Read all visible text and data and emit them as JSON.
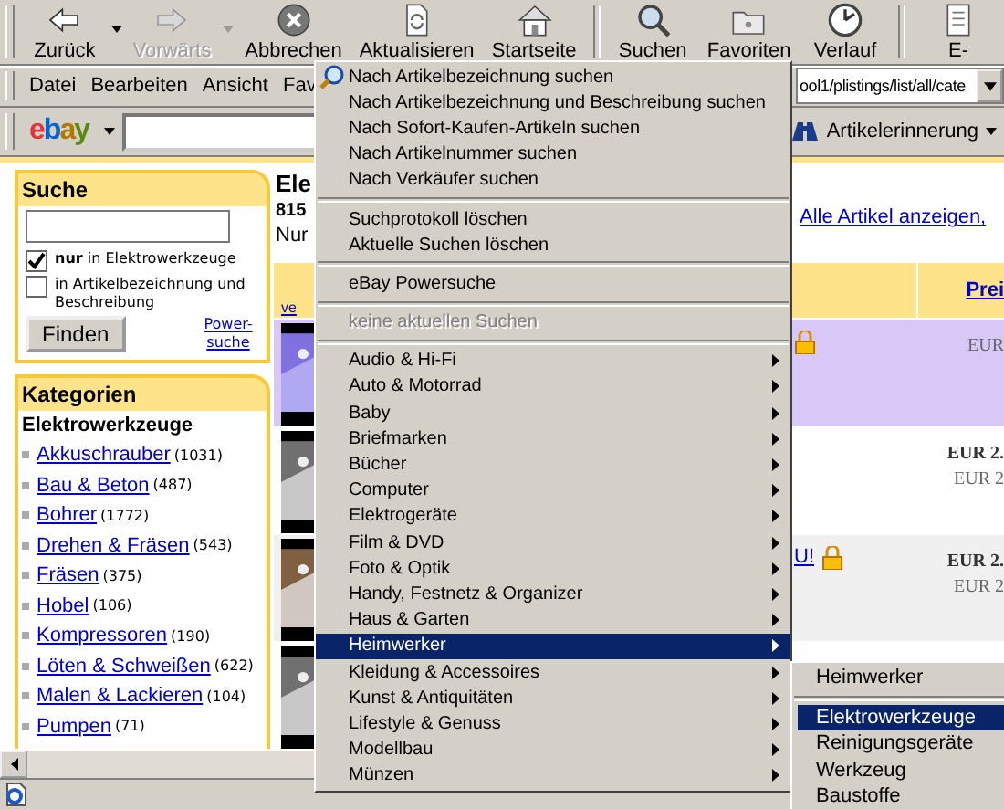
{
  "toolbar": {
    "buttons": [
      {
        "label": "Zurück",
        "disabled": false,
        "dropdown": true
      },
      {
        "label": "Vorwärts",
        "disabled": true,
        "dropdown": true
      },
      {
        "label": "Abbrechen",
        "disabled": false,
        "dropdown": false
      },
      {
        "label": "Aktualisieren",
        "disabled": false,
        "dropdown": false
      },
      {
        "label": "Startseite",
        "disabled": false,
        "dropdown": false
      },
      {
        "label": "Suchen",
        "disabled": false,
        "dropdown": false
      },
      {
        "label": "Favoriten",
        "disabled": false,
        "dropdown": false
      },
      {
        "label": "Verlauf",
        "disabled": false,
        "dropdown": false
      },
      {
        "label": "E-",
        "disabled": false,
        "dropdown": false
      }
    ]
  },
  "menu_bar": {
    "items": [
      "Datei",
      "Bearbeiten",
      "Ansicht",
      "Fav"
    ]
  },
  "address": {
    "value": "ool1/plistings/list/all/cate"
  },
  "ebay_toolbar": {
    "logo": "ebay",
    "button": "Artikelerinnerung"
  },
  "search_box": {
    "title": "Suche",
    "options": [
      {
        "label": "**nur** in Elektrowerkzeuge",
        "checked": true
      },
      {
        "label": "in Artikelbezeichnung und Beschreibung",
        "checked": false
      }
    ],
    "button": "Finden",
    "link": "Power-suche"
  },
  "categories": {
    "title": "Kategorien",
    "heading": "Elektrowerkzeuge",
    "items": [
      {
        "name": "Akkuschrauber",
        "count": "(1031)"
      },
      {
        "name": "Bau & Beton",
        "count": "(487)"
      },
      {
        "name": "Bohrer",
        "count": "(1772)"
      },
      {
        "name": "Drehen & Fräsen",
        "count": "(543)"
      },
      {
        "name": "Fräsen",
        "count": "(375)"
      },
      {
        "name": "Hobel",
        "count": "(106)"
      },
      {
        "name": "Kompressoren",
        "count": "(190)"
      },
      {
        "name": "Löten & Schweißen",
        "count": "(622)"
      },
      {
        "name": "Malen & Lackieren",
        "count": "(104)"
      },
      {
        "name": "Pumpen",
        "count": "(71)"
      }
    ]
  },
  "page": {
    "title": "Ele",
    "count": "815",
    "note": "Nur",
    "view_link": "ve",
    "all_link": "Alle Artikel anzeigen,",
    "price_header": "Prei",
    "rows": [
      {
        "kind": "featured",
        "lock": true,
        "price": "EUR"
      },
      {
        "kind": "plain",
        "lock": false,
        "price": "EUR 2.",
        "sub": "EUR 2"
      },
      {
        "kind": "shaded",
        "lock": true,
        "link": "U!",
        "price": "EUR 2.",
        "sub": "EUR 2"
      },
      {
        "kind": "plain",
        "lock": false
      }
    ]
  },
  "menu": {
    "items": [
      {
        "kind": "item",
        "label": "Nach Artikelbezeichnung suchen",
        "icon": true
      },
      {
        "kind": "item",
        "label": "Nach Artikelbezeichnung und Beschreibung suchen"
      },
      {
        "kind": "item",
        "label": "Nach Sofort-Kaufen-Artikeln suchen"
      },
      {
        "kind": "item",
        "label": "Nach Artikelnummer suchen"
      },
      {
        "kind": "item",
        "label": "Nach Verkäufer suchen"
      },
      {
        "kind": "separator"
      },
      {
        "kind": "item",
        "label": "Suchprotokoll löschen"
      },
      {
        "kind": "item",
        "label": "Aktuelle Suchen löschen"
      },
      {
        "kind": "separator"
      },
      {
        "kind": "item",
        "label": "eBay Powersuche"
      },
      {
        "kind": "separator"
      },
      {
        "kind": "item",
        "label": "keine aktuellen Suchen",
        "disabled": true
      },
      {
        "kind": "separator"
      },
      {
        "kind": "submenu",
        "label": "Audio & Hi-Fi",
        "selected": false
      },
      {
        "kind": "submenu",
        "label": "Auto & Motorrad",
        "selected": false
      },
      {
        "kind": "submenu",
        "label": "Baby",
        "selected": false
      },
      {
        "kind": "submenu",
        "label": "Briefmarken",
        "selected": false
      },
      {
        "kind": "submenu",
        "label": "Bücher",
        "selected": false
      },
      {
        "kind": "submenu",
        "label": "Computer",
        "selected": false
      },
      {
        "kind": "submenu",
        "label": "Elektrogeräte",
        "selected": false
      },
      {
        "kind": "submenu",
        "label": "Film & DVD",
        "selected": false
      },
      {
        "kind": "submenu",
        "label": "Foto & Optik",
        "selected": false
      },
      {
        "kind": "submenu",
        "label": "Handy, Festnetz & Organizer",
        "selected": false
      },
      {
        "kind": "submenu",
        "label": "Haus & Garten",
        "selected": false
      },
      {
        "kind": "submenu",
        "label": "Heimwerker",
        "selected": true
      },
      {
        "kind": "submenu",
        "label": "Kleidung & Accessoires",
        "selected": false
      },
      {
        "kind": "submenu",
        "label": "Kunst & Antiquitäten",
        "selected": false
      },
      {
        "kind": "submenu",
        "label": "Lifestyle & Genuss",
        "selected": false
      },
      {
        "kind": "submenu",
        "label": "Modellbau",
        "selected": false
      },
      {
        "kind": "submenu",
        "label": "Münzen",
        "selected": false
      }
    ]
  },
  "submenu": {
    "items": [
      {
        "kind": "item",
        "label": "Heimwerker",
        "selected": false
      },
      {
        "kind": "separator"
      },
      {
        "kind": "item",
        "label": "Elektrowerkzeuge",
        "selected": true
      },
      {
        "kind": "item",
        "label": "Reinigungsgeräte",
        "selected": false
      },
      {
        "kind": "item",
        "label": "Werkzeug",
        "selected": false
      },
      {
        "kind": "item",
        "label": "Baustoffe",
        "selected": false
      }
    ]
  }
}
